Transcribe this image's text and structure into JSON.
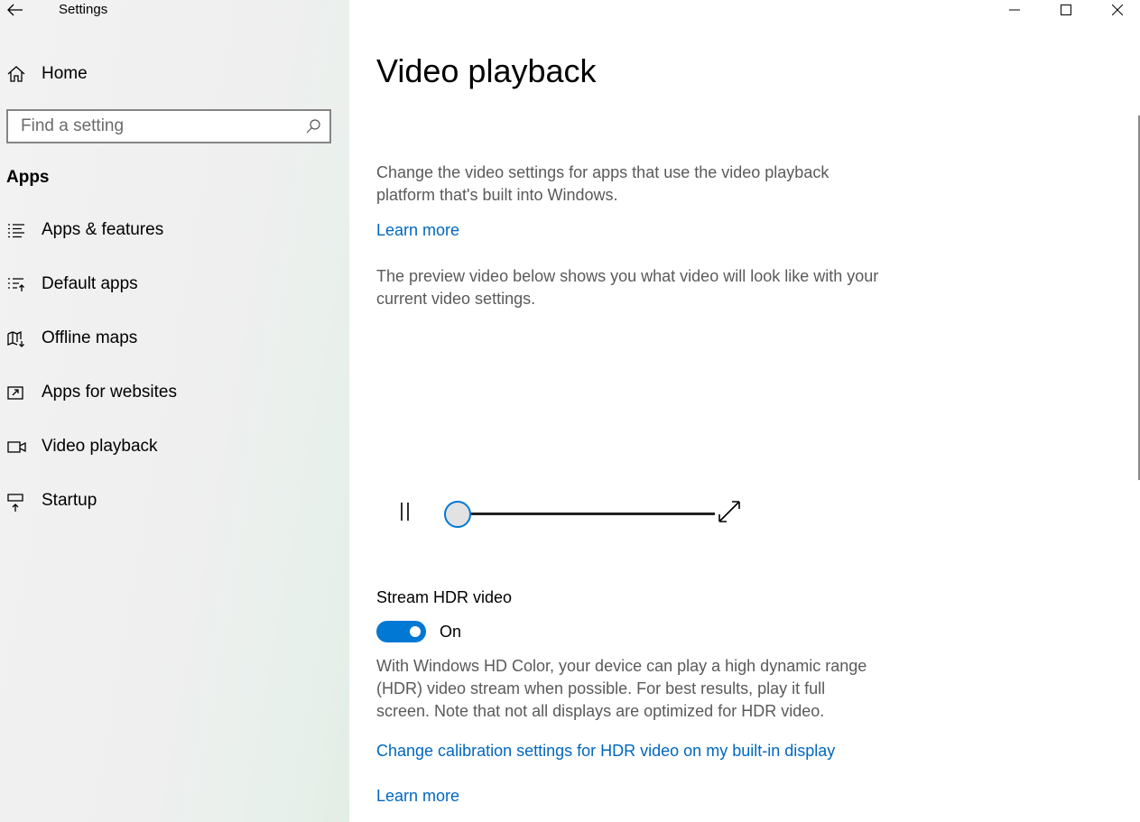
{
  "window": {
    "title": "Settings",
    "controls": [
      "minimize-icon",
      "maximize-icon",
      "close-icon"
    ]
  },
  "sidebar": {
    "home_label": "Home",
    "search_placeholder": "Find a setting",
    "section_heading": "Apps",
    "items": [
      {
        "label": "Apps & features",
        "icon": "apps-features-icon"
      },
      {
        "label": "Default apps",
        "icon": "default-apps-icon"
      },
      {
        "label": "Offline maps",
        "icon": "offline-maps-icon"
      },
      {
        "label": "Apps for websites",
        "icon": "apps-websites-icon"
      },
      {
        "label": "Video playback",
        "icon": "video-playback-icon"
      },
      {
        "label": "Startup",
        "icon": "startup-icon"
      }
    ]
  },
  "main": {
    "title": "Video playback",
    "intro": "Change the video settings for apps that use the video playback platform that's built into Windows.",
    "learn_more_1": "Learn more",
    "preview_desc": "The preview video below shows you what video will look like with your current video settings.",
    "player": {
      "progress": 0
    },
    "hdr": {
      "label": "Stream HDR video",
      "state": "On",
      "enabled": true,
      "description": "With Windows HD Color, your device can play a high dynamic range (HDR) video stream when possible. For best results, play it full screen. Note that not all displays are optimized for HDR video.",
      "calibration_link": "Change calibration settings for HDR video on my built-in display",
      "learn_more_2": "Learn more"
    }
  },
  "colors": {
    "accent": "#0078d4",
    "link": "#0067c0",
    "secondary_text": "#5a5a5a"
  }
}
